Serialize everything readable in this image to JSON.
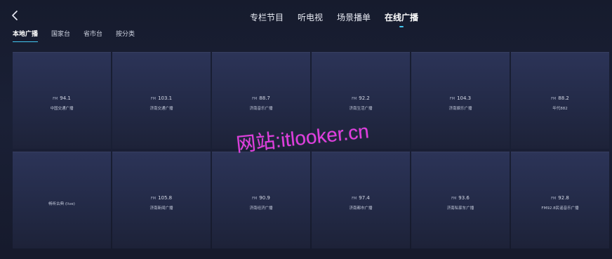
{
  "header": {
    "tabs": [
      {
        "label": "专栏节目"
      },
      {
        "label": "听电视"
      },
      {
        "label": "场景播单"
      },
      {
        "label": "在线广播"
      }
    ]
  },
  "subtabs": [
    {
      "label": "本地广播"
    },
    {
      "label": "国家台"
    },
    {
      "label": "省市台"
    },
    {
      "label": "按分类"
    }
  ],
  "stations": [
    {
      "fm": "FM",
      "freq": "94.1",
      "name": "中国交通广播"
    },
    {
      "fm": "FM",
      "freq": "103.1",
      "name": "济南交通广播"
    },
    {
      "fm": "FM",
      "freq": "88.7",
      "name": "济南音乐广播"
    },
    {
      "fm": "FM",
      "freq": "92.2",
      "name": "济南生活广播"
    },
    {
      "fm": "FM",
      "freq": "104.3",
      "name": "济南娱乐广播"
    },
    {
      "fm": "FM",
      "freq": "88.2",
      "name": "年代882"
    },
    {
      "name": "畅听古典 (live)"
    },
    {
      "fm": "FM",
      "freq": "105.8",
      "name": "济南新闻广播"
    },
    {
      "fm": "FM",
      "freq": "90.9",
      "name": "济南经济广播"
    },
    {
      "fm": "FM",
      "freq": "97.4",
      "name": "济南都市广播"
    },
    {
      "fm": "FM",
      "freq": "93.6",
      "name": "济南私家车广播"
    },
    {
      "fm": "FM",
      "freq": "92.8",
      "name": "FM92.8民谣音乐广播"
    }
  ],
  "watermark": "网站:itlooker.cn",
  "colors": {
    "accent": "#43c7f0",
    "watermark": "#e23be0"
  }
}
